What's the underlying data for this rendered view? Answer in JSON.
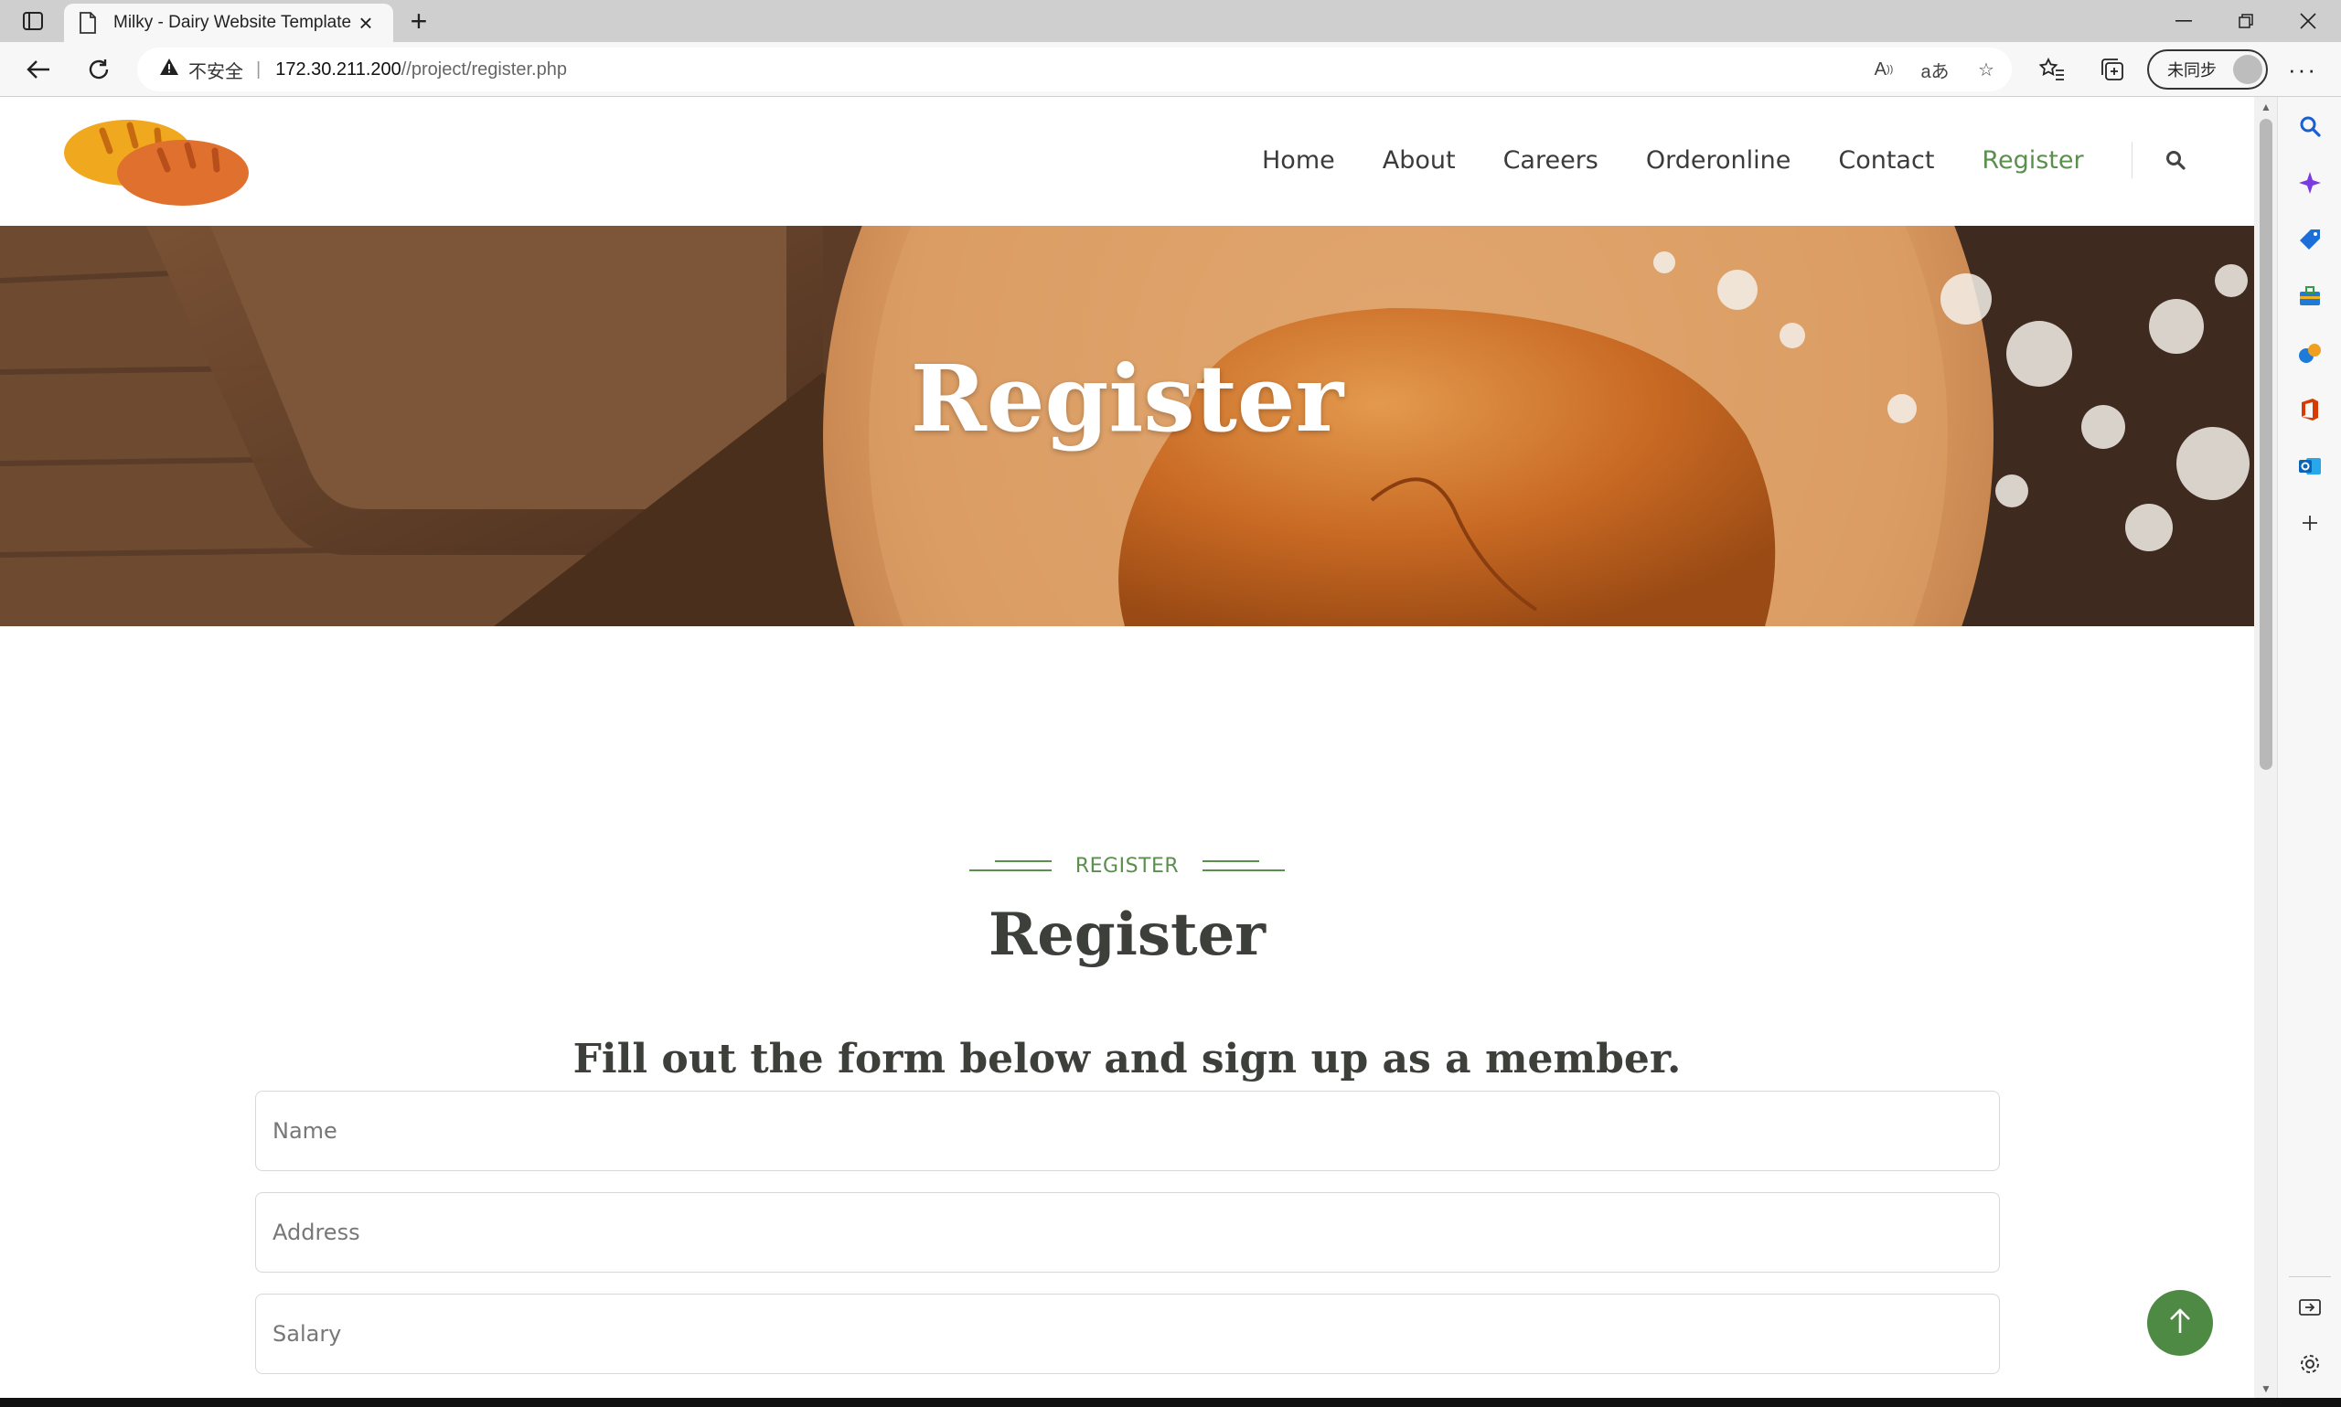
{
  "browser": {
    "tab_title": "Milky - Dairy Website Template",
    "security_label": "不安全",
    "url_host": "172.30.211.200",
    "url_path": "//project/register.php",
    "sync_label": "未同步"
  },
  "site": {
    "nav": {
      "items": [
        {
          "label": "Home"
        },
        {
          "label": "About"
        },
        {
          "label": "Careers"
        },
        {
          "label": "Orderonline"
        },
        {
          "label": "Contact"
        },
        {
          "label": "Register"
        }
      ],
      "active": "Register"
    },
    "hero": {
      "title": "Register"
    },
    "section": {
      "eyebrow": "REGISTER",
      "title": "Register",
      "subtitle": "Fill out the form below and sign up as a member."
    },
    "form": {
      "name_placeholder": "Name",
      "address_placeholder": "Address",
      "salary_placeholder": "Salary"
    }
  },
  "colors": {
    "accent_green": "#5a8f4e",
    "back_to_top": "#4e8a44",
    "heading": "#3d3f3b"
  },
  "icons": {
    "tab_actions": "tab-actions-icon",
    "document": "document-icon",
    "back": "arrow-left-icon",
    "reload": "reload-icon",
    "warning": "warning-icon",
    "search": "search-icon",
    "back_to_top": "arrow-up-icon"
  }
}
